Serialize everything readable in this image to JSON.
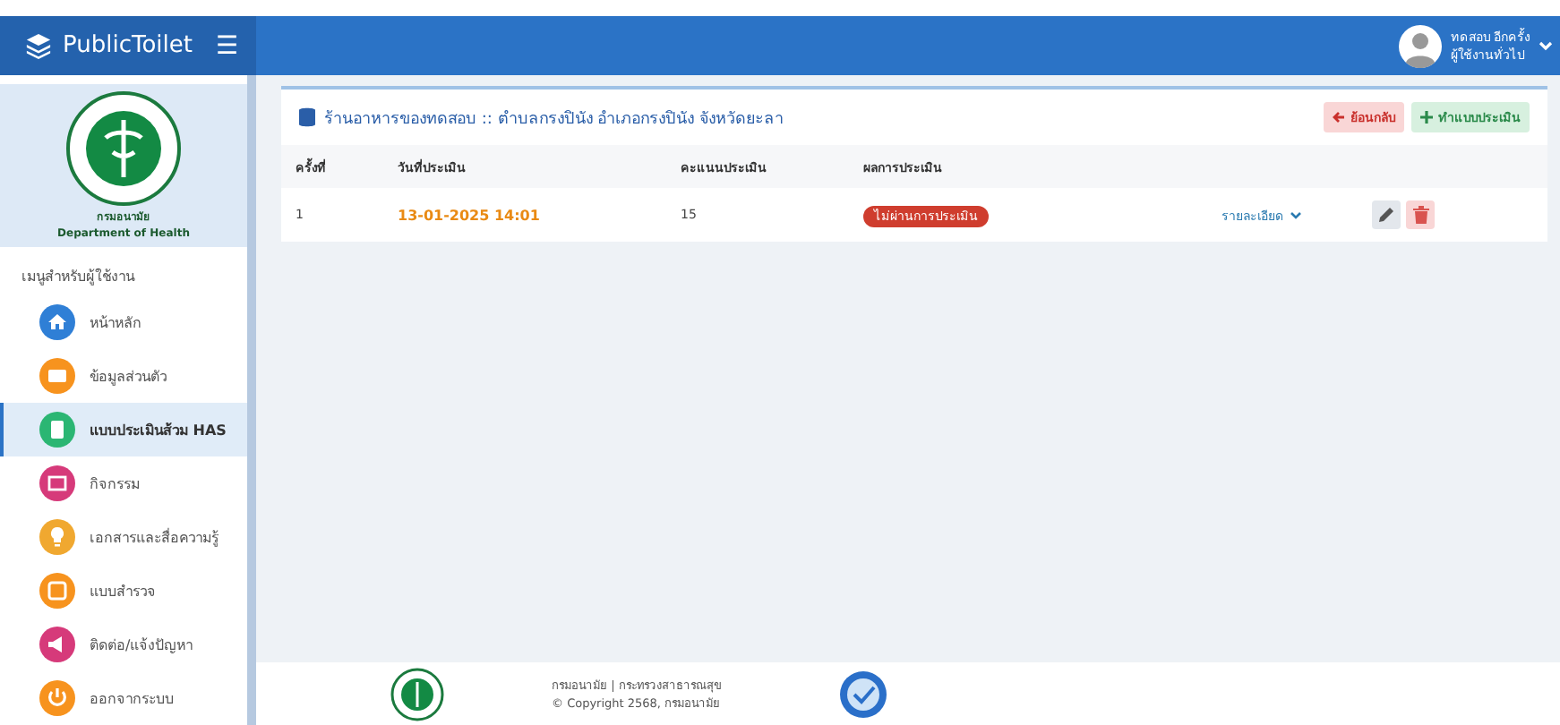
{
  "brand": {
    "name": "PublicToilet",
    "menu_glyph": "☰"
  },
  "user": {
    "name": "ทดสอบ อีกครั้ง",
    "role": "ผู้ใช้งานทั่วไป"
  },
  "sidebar": {
    "org_th": "กรมอนามัย",
    "org_en": "Department of Health",
    "section": "เมนูสำหรับผู้ใช้งาน",
    "items": [
      {
        "label": "หน้าหลัก",
        "color": "#2f7fd6",
        "selected": false
      },
      {
        "label": "ข้อมูลส่วนตัว",
        "color": "#f7931e",
        "selected": false
      },
      {
        "label": "แบบประเมินส้วม HAS",
        "color": "#2bb673",
        "selected": true
      },
      {
        "label": "กิจกรรม",
        "color": "#d63a7a",
        "selected": false
      },
      {
        "label": "เอกสารและสื่อความรู้",
        "color": "#f0a830",
        "selected": false
      },
      {
        "label": "แบบสำรวจ",
        "color": "#f7931e",
        "selected": false
      },
      {
        "label": "ติดต่อ/แจ้งปัญหา",
        "color": "#d63a7a",
        "selected": false
      },
      {
        "label": "ออกจากระบบ",
        "color": "#f7931e",
        "selected": false
      }
    ]
  },
  "card": {
    "title": "ร้านอาหารของทดสอบ :: ตำบลกรงปินัง อำเภอกรงปินัง จังหวัดยะลา",
    "back_button": "ย้อนกลับ",
    "new_button": "ทำแบบประเมิน",
    "table": {
      "columns": [
        "ครั้งที่",
        "วันที่ประเมิน",
        "คะแนนประเมิน",
        "ผลการประเมิน"
      ],
      "rows": [
        {
          "round": "1",
          "date": "13-01-2025 14:01",
          "score": "15",
          "result": "ไม่ผ่านการประเมิน",
          "detail": "รายละเอียด"
        }
      ]
    }
  },
  "footer": {
    "line1": "กรมอนามัย | กระทรวงสาธารณสุข",
    "line2": "© Copyright 2568, กรมอนามัย"
  }
}
